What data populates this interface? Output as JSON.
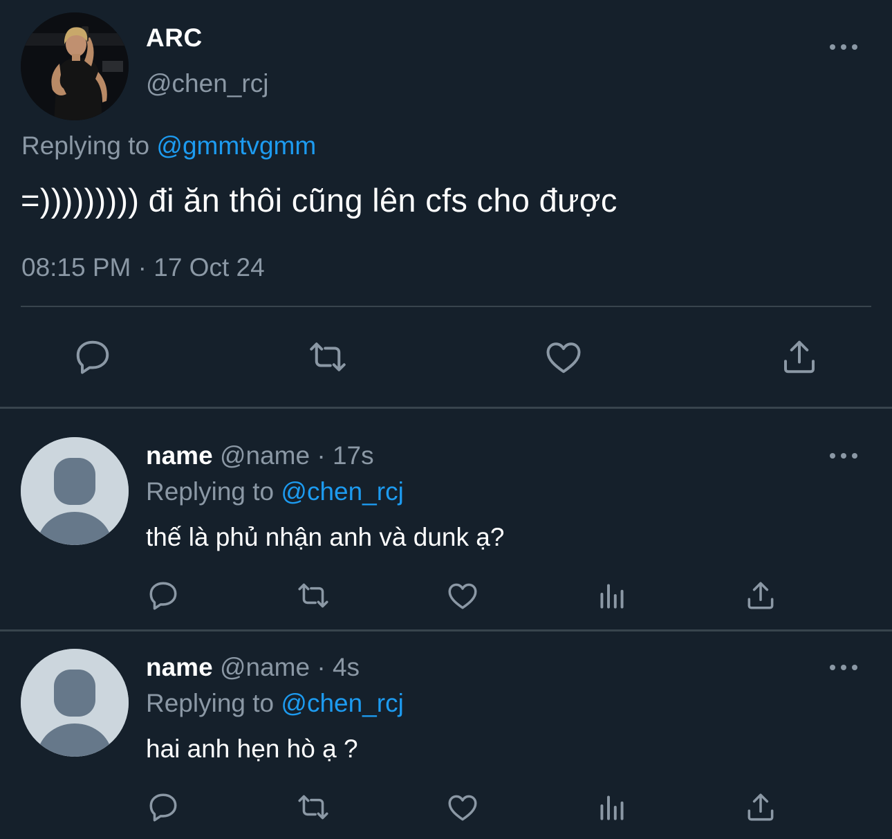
{
  "main_tweet": {
    "display_name": "ARC",
    "handle": "@chen_rcj",
    "replying_prefix": "Replying to",
    "replying_to": "@gmmtvgmm",
    "text": "=))))))))) đi ăn thôi cũng lên cfs cho được",
    "timestamp": "08:15 PM · 17 Oct 24",
    "actions": [
      "reply-icon",
      "retweet-icon",
      "like-icon",
      "share-icon"
    ]
  },
  "replies": [
    {
      "name": "name",
      "handle": "@name",
      "time": "· 17s",
      "replying_prefix": "Replying to",
      "replying_to": "@chen_rcj",
      "text": "thế là phủ nhận anh và dunk ạ?",
      "actions": [
        "reply-icon",
        "retweet-icon",
        "like-icon",
        "analytics-icon",
        "share-icon"
      ]
    },
    {
      "name": "name",
      "handle": "@name",
      "time": "· 4s",
      "replying_prefix": "Replying to",
      "replying_to": "@chen_rcj",
      "text": "hai anh hẹn hò ạ ?",
      "actions": [
        "reply-icon",
        "retweet-icon",
        "like-icon",
        "analytics-icon",
        "share-icon"
      ]
    }
  ],
  "colors": {
    "background": "#15202b",
    "text_primary": "#ffffff",
    "text_secondary": "#8b98a5",
    "accent": "#1d9bf0",
    "divider": "#38444d",
    "default_avatar_bg": "#ccd6dd",
    "default_avatar_fg": "#66788a"
  }
}
